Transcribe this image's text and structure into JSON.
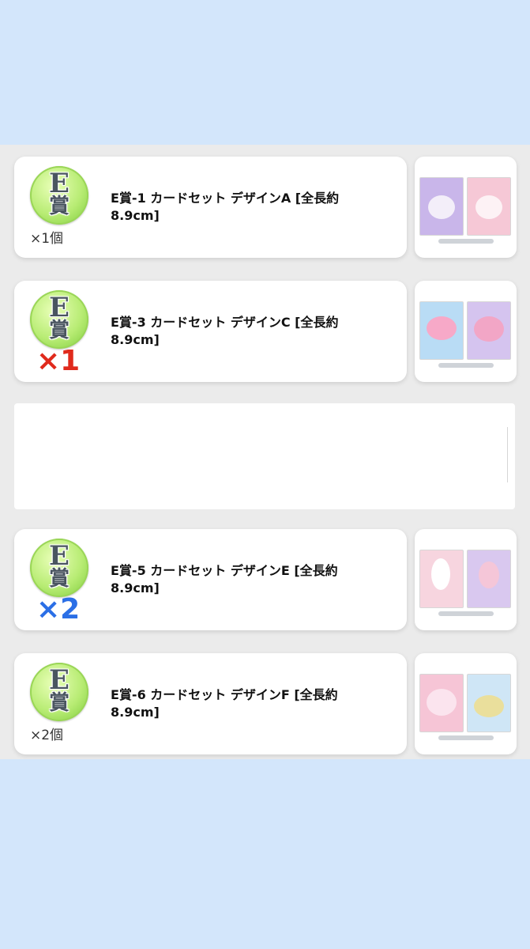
{
  "items": [
    {
      "badge_letter": "E",
      "badge_kanji": "賞",
      "title": "E賞-1 カードセット デザインA [全長約8.9cm]",
      "qty": "×1個",
      "thumb_colors": [
        "#c9b6ea",
        "#f6c8d6"
      ]
    },
    {
      "badge_letter": "E",
      "badge_kanji": "賞",
      "title": "E賞-3 カードセット デザインC [全長約8.9cm]",
      "qty_overlay": "×1",
      "qty_overlay_color": "#e02a1c",
      "thumb_colors": [
        "#b9dcf5",
        "#d5c4ef"
      ]
    },
    {
      "badge_letter": "E",
      "badge_kanji": "賞",
      "title": "E賞-5 カードセット デザインE [全長約8.9cm]",
      "qty_overlay": "×2",
      "qty_overlay_color": "#2b6fe6",
      "thumb_colors": [
        "#f7d5df",
        "#d9c8ef"
      ]
    },
    {
      "badge_letter": "E",
      "badge_kanji": "賞",
      "title": "E賞-6 カードセット デザインF [全長約8.9cm]",
      "qty": "×2個",
      "thumb_colors": [
        "#f6c5d6",
        "#cfe6f6"
      ]
    }
  ]
}
